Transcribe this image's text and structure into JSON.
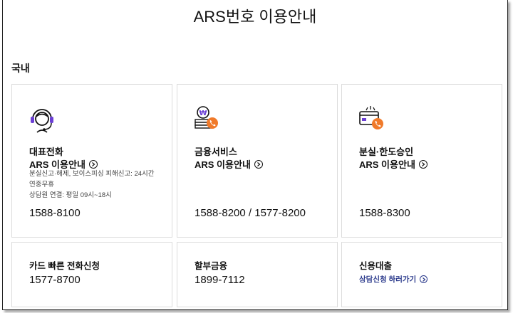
{
  "header": {
    "title": "ARS번호 이용안내"
  },
  "section": {
    "title": "국내"
  },
  "cards": [
    {
      "name": "대표전화",
      "ars_label": "ARS 이용안내",
      "notes": [
        "분실신고·해제, 보이스피싱 피해신고: 24시간",
        "연중무휴",
        "상담원 연결: 평일 09시~18시"
      ],
      "phone": "1588-8100",
      "icon": "headset-agent-icon"
    },
    {
      "name": "금융서비스",
      "ars_label": "ARS 이용안내",
      "phone": "1588-8200 / 1577-8200",
      "icon": "money-phone-icon"
    },
    {
      "name": "분실·한도승인",
      "ars_label": "ARS 이용안내",
      "phone": "1588-8300",
      "icon": "card-phone-icon"
    },
    {
      "name": "카드 빠른 전화신청",
      "phone": "1577-8700"
    },
    {
      "name": "할부금융",
      "phone": "1899-7112"
    },
    {
      "name": "신용대출",
      "link_label": "상담신청 하러가기"
    }
  ],
  "colors": {
    "accent_purple": "#6b3fd4",
    "accent_orange": "#f07a2a",
    "link_blue": "#2b3a8c"
  }
}
